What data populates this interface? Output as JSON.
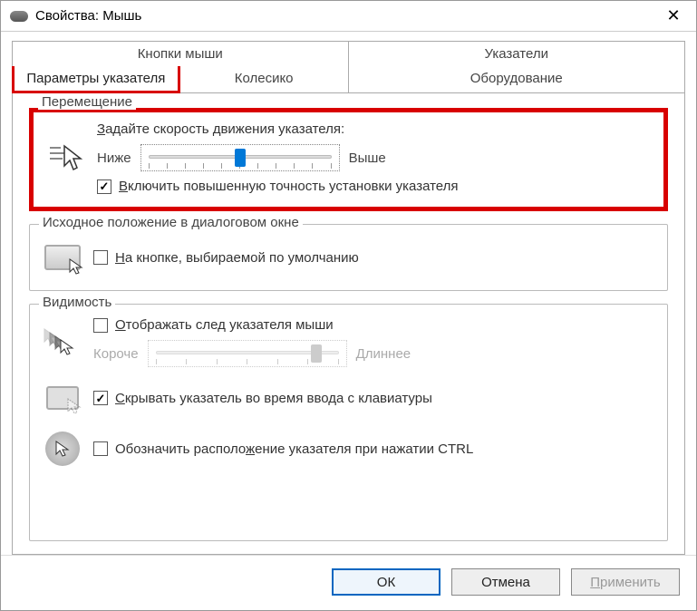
{
  "window": {
    "title": "Свойства: Мышь"
  },
  "tabs": {
    "buttons": "Кнопки мыши",
    "pointers": "Указатели",
    "pointer_options": "Параметры указателя",
    "wheel": "Колесико",
    "hardware": "Оборудование"
  },
  "motion": {
    "group": "Перемещение",
    "heading": "Задайте скорость движения указателя:",
    "slower": "Ниже",
    "faster": "Выше",
    "enhance": "Включить повышенную точность установки указателя",
    "enhance_checked": true,
    "speed_pct": 50
  },
  "snap": {
    "group": "Исходное положение в диалоговом окне",
    "label": "На кнопке, выбираемой по умолчанию",
    "checked": false
  },
  "visibility": {
    "group": "Видимость",
    "trails_label": "Отображать след указателя мыши",
    "trails_checked": false,
    "trail_short": "Короче",
    "trail_long": "Длиннее",
    "trail_pct": 85,
    "hide_typing_label": "Скрывать указатель во время ввода с клавиатуры",
    "hide_typing_checked": true,
    "locate_ctrl_label": "Обозначить расположение указателя при нажатии CTRL",
    "locate_ctrl_checked": false
  },
  "buttons": {
    "ok": "ОК",
    "cancel": "Отмена",
    "apply": "Применить"
  }
}
